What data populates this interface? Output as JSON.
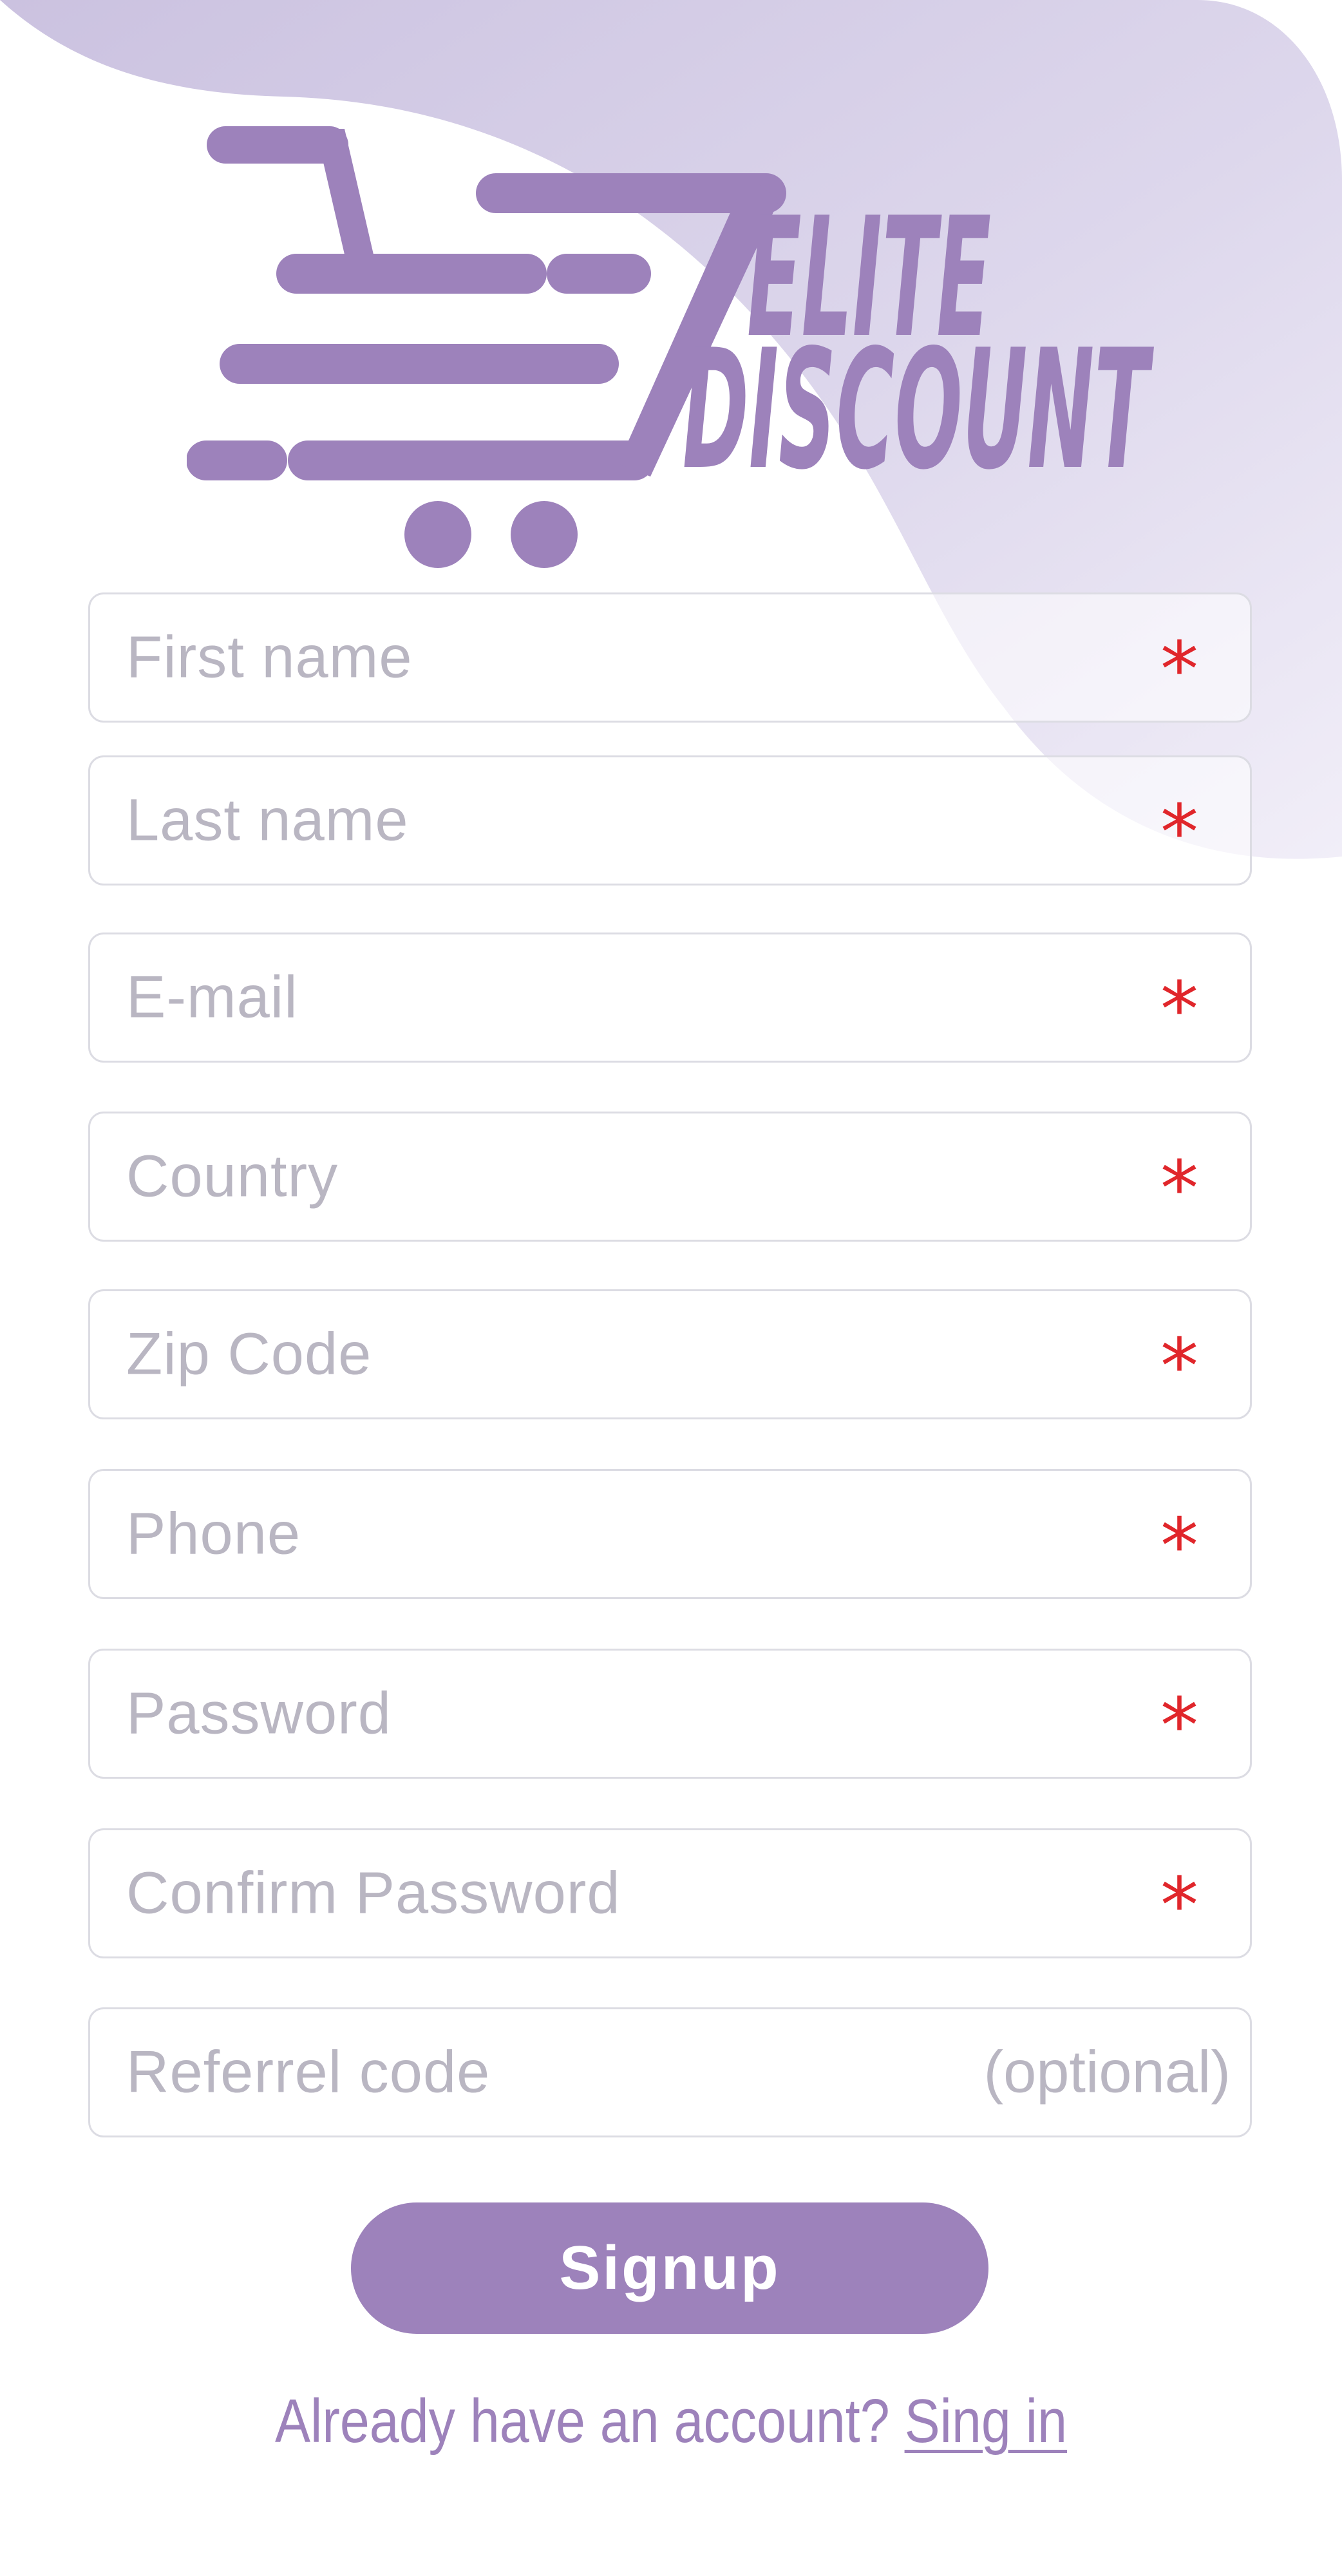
{
  "brand": {
    "line1": "ELITE",
    "line2": "DISCOUNT",
    "color": "#9d82bb",
    "icon": "shopping-cart-icon"
  },
  "form": {
    "first_name": {
      "placeholder": "First name",
      "required": "*"
    },
    "last_name": {
      "placeholder": "Last name",
      "required": "*"
    },
    "email": {
      "placeholder": "E-mail",
      "required": "*"
    },
    "country": {
      "placeholder": "Country",
      "required": "*"
    },
    "zip": {
      "placeholder": "Zip Code",
      "required": "*"
    },
    "phone": {
      "placeholder": "Phone",
      "required": "*"
    },
    "password": {
      "placeholder": "Password",
      "required": "*"
    },
    "confirm_password": {
      "placeholder": "Confirm Password",
      "required": "*"
    },
    "referral": {
      "placeholder": "Referrel code",
      "optional": "(optional)"
    }
  },
  "signup_label": "Signup",
  "footer": {
    "prompt": "Already have an account?",
    "link": "Sing in"
  },
  "colors": {
    "accent": "#9d82bb",
    "required": "#e0262b",
    "placeholder": "#b9b6c2",
    "blob": "#cfc7e2"
  }
}
